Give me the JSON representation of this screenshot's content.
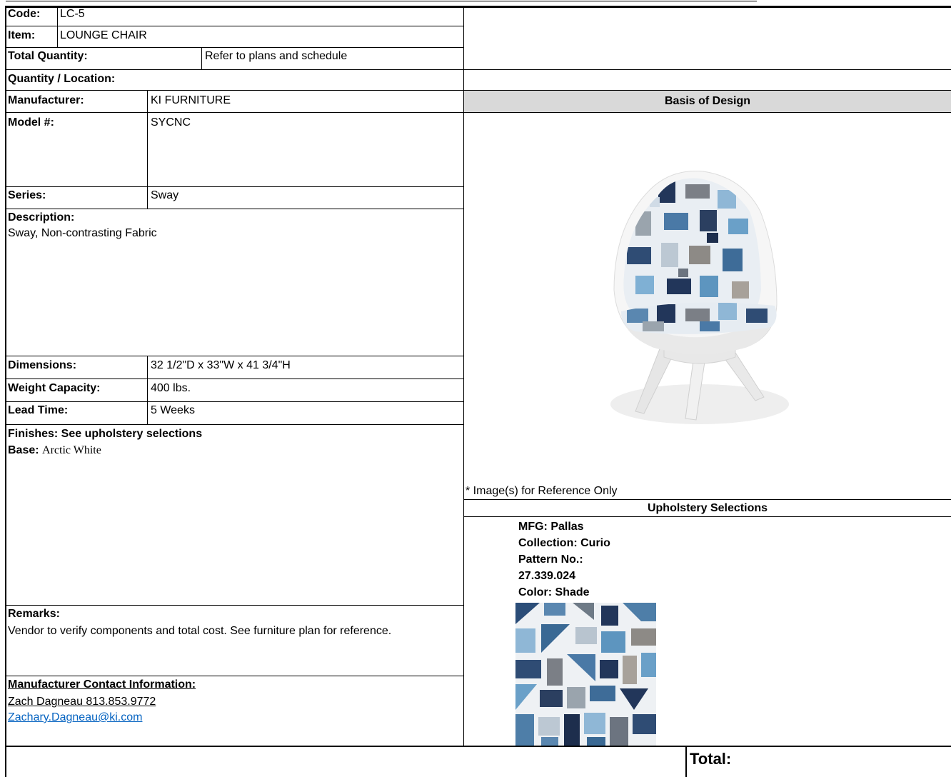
{
  "code": {
    "label": "Code:",
    "value": "LC-5"
  },
  "item": {
    "label": "Item:",
    "value": "LOUNGE CHAIR"
  },
  "total_quantity": {
    "label": "Total Quantity:",
    "value": "Refer to plans and schedule"
  },
  "quantity_location": {
    "label": "Quantity / Location:"
  },
  "manufacturer": {
    "label": "Manufacturer:",
    "value": "KI FURNITURE"
  },
  "model": {
    "label": "Model #:",
    "value": "SYCNC"
  },
  "series": {
    "label": "Series:",
    "value": "Sway"
  },
  "description": {
    "label": "Description:",
    "value": "Sway, Non-contrasting Fabric"
  },
  "dimensions": {
    "label": "Dimensions:",
    "value": "32 1/2\"D x 33\"W x 41 3/4\"H"
  },
  "weight_capacity": {
    "label": "Weight Capacity:",
    "value": "400 lbs."
  },
  "lead_time": {
    "label": "Lead Time:",
    "value": "5 Weeks"
  },
  "finishes": {
    "heading": "Finishes: See upholstery selections",
    "base_label": "Base:",
    "base_value": "Arctic White"
  },
  "remarks": {
    "label": "Remarks:",
    "value": "Vendor to verify components and total cost. See furniture plan for reference."
  },
  "contact": {
    "heading": "Manufacturer Contact Information:",
    "name_phone": "Zach Dagneau 813.853.9772",
    "email": "Zachary.Dagneau@ki.com"
  },
  "basis_of_design": {
    "header": "Basis of Design",
    "image_note": "* Image(s) for Reference Only",
    "image_icon": "lounge-chair-photo"
  },
  "upholstery": {
    "header": "Upholstery Selections",
    "lines": [
      "MFG: Pallas",
      "Collection: Curio",
      "Pattern No.:",
      "27.339.024",
      "Color: Shade"
    ],
    "swatch_icon": "fabric-swatch"
  },
  "footer": {
    "total_label": "Total:"
  },
  "colors": {
    "header_bg": "#d9d9d9",
    "link": "#0563c1",
    "fabric_blue": "#5a87b0",
    "fabric_navy": "#22365a",
    "fabric_grey": "#7b7f86"
  }
}
